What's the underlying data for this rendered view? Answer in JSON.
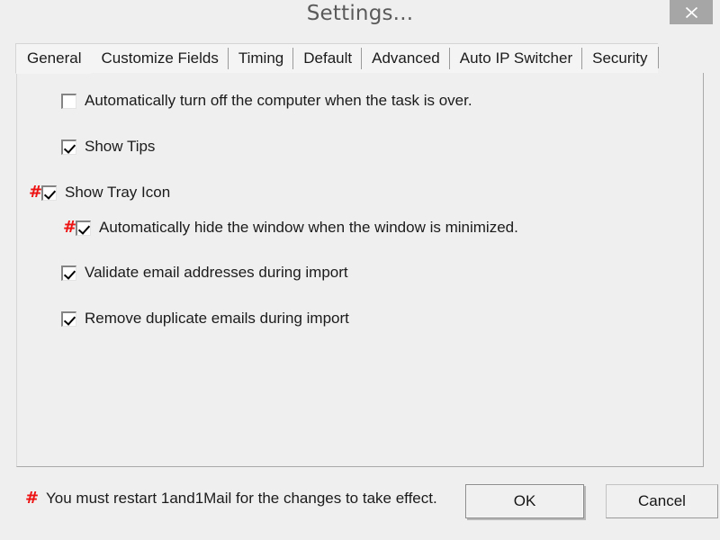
{
  "window": {
    "title": "Settings...",
    "close_icon": "close-icon"
  },
  "tabs": [
    {
      "label": "General",
      "active": true
    },
    {
      "label": "Customize Fields",
      "active": false
    },
    {
      "label": "Timing",
      "active": false
    },
    {
      "label": "Default",
      "active": false
    },
    {
      "label": "Advanced",
      "active": false
    },
    {
      "label": "Auto IP Switcher",
      "active": false
    },
    {
      "label": "Security",
      "active": false
    }
  ],
  "general": {
    "options": [
      {
        "label": "Automatically turn off the computer when the task is over.",
        "checked": false,
        "marker": "",
        "indent": false
      },
      {
        "label": "Show Tips",
        "checked": true,
        "marker": "",
        "indent": false
      },
      {
        "label": "Show Tray Icon",
        "checked": true,
        "marker": "#",
        "indent": false
      },
      {
        "label": "Automatically hide the window when the window is minimized.",
        "checked": true,
        "marker": "#",
        "indent": true
      },
      {
        "label": "Validate email addresses during import",
        "checked": true,
        "marker": "",
        "indent": false
      },
      {
        "label": "Remove duplicate emails during import",
        "checked": true,
        "marker": "",
        "indent": false
      }
    ]
  },
  "footer": {
    "marker": "#",
    "note": "You must restart 1and1Mail for the changes to take effect.",
    "ok_label": "OK",
    "cancel_label": "Cancel"
  },
  "colors": {
    "marker_red": "#ee1111",
    "dialog_background": "#efefef",
    "close_button": "#a6a6a6"
  }
}
